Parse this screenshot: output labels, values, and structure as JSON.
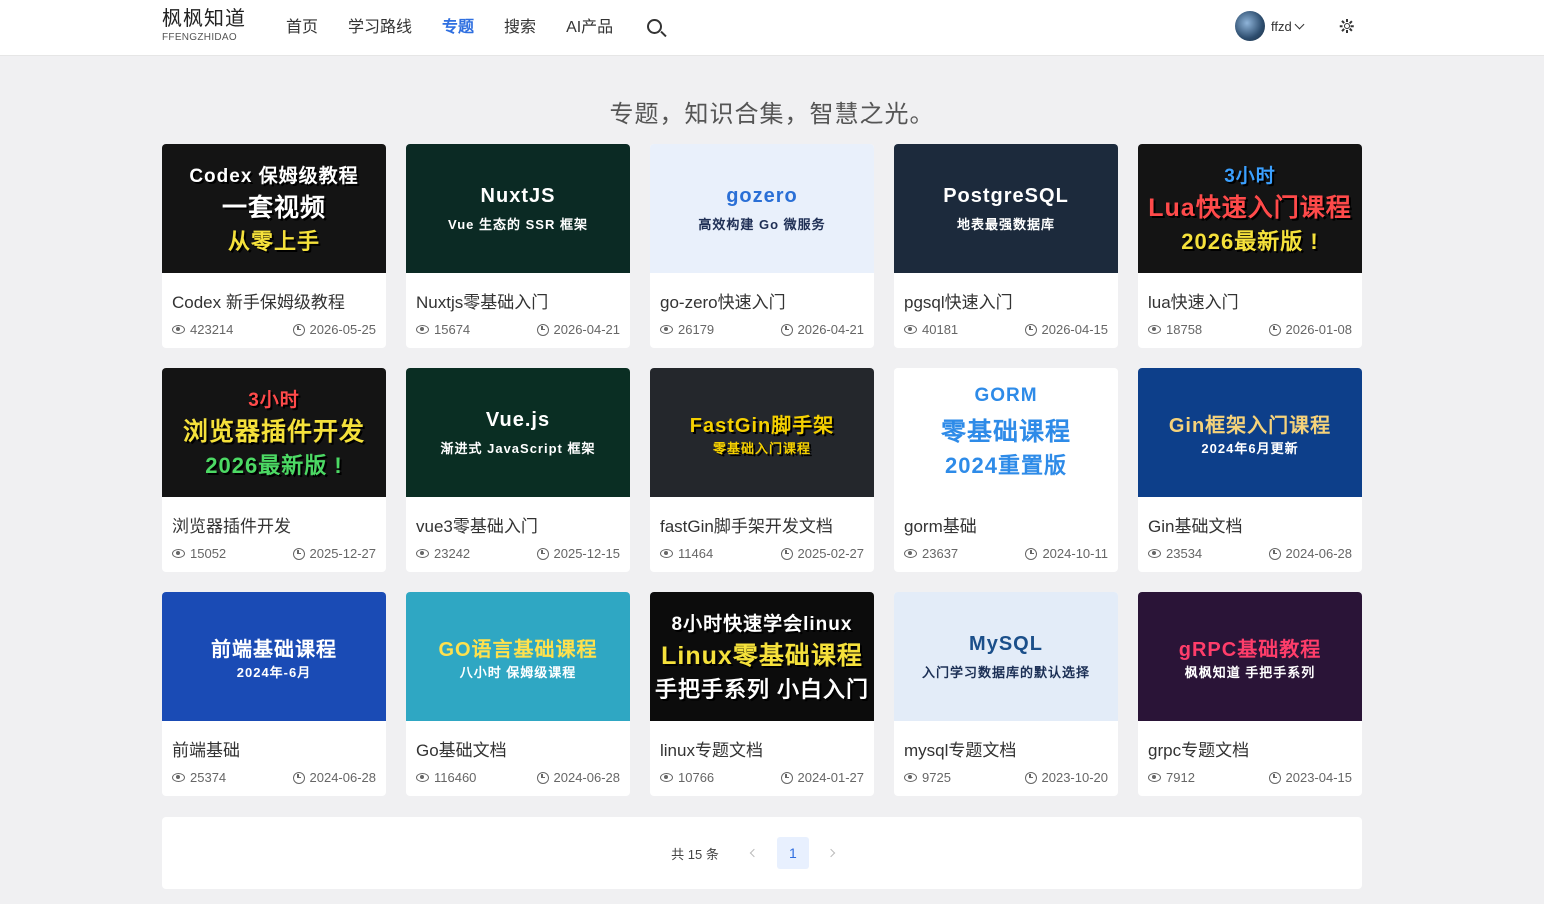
{
  "header": {
    "logo_title": "枫枫知道",
    "logo_sub": "FFENGZHIDAO",
    "nav": [
      "首页",
      "学习路线",
      "专题",
      "搜索",
      "AI产品"
    ],
    "active_index": 2,
    "user_name": "ffzd"
  },
  "slogan": "专题，知识合集，智慧之光。",
  "cards": [
    {
      "title": "Codex 新手保姆级教程",
      "views": "423214",
      "date": "2026-05-25",
      "cover": {
        "bg": "#141414",
        "lines": [
          {
            "t": "Codex 保姆级教程",
            "c": "#ffffff"
          },
          {
            "t": "一套视频",
            "c": "#ffffff"
          },
          {
            "t": "从零上手",
            "c": "#f5e13b"
          }
        ]
      }
    },
    {
      "title": "Nuxtjs零基础入门",
      "views": "15674",
      "date": "2026-04-21",
      "cover": {
        "bg": "#0b2a24",
        "lines": [
          {
            "t": "NuxtJS",
            "c": "#ffffff"
          },
          {
            "t": "Vue 生态的 SSR 框架",
            "c": "#ffffff"
          }
        ]
      }
    },
    {
      "title": "go-zero快速入门",
      "views": "26179",
      "date": "2026-04-21",
      "cover": {
        "bg": "#e9f0fb",
        "lines": [
          {
            "t": "gozero",
            "c": "#2a6fd6"
          },
          {
            "t": "高效构建 Go 微服务",
            "c": "#1f2f55"
          }
        ]
      }
    },
    {
      "title": "pgsql快速入门",
      "views": "40181",
      "date": "2026-04-15",
      "cover": {
        "bg": "#1c2a3c",
        "lines": [
          {
            "t": "PostgreSQL",
            "c": "#ffffff"
          },
          {
            "t": "地表最强数据库",
            "c": "#ffffff"
          }
        ]
      }
    },
    {
      "title": "lua快速入门",
      "views": "18758",
      "date": "2026-01-08",
      "cover": {
        "bg": "#141414",
        "lines": [
          {
            "t": "3小时",
            "c": "#3ba0ff"
          },
          {
            "t": "Lua快速入门课程",
            "c": "#ff4a4a"
          },
          {
            "t": "2026最新版 !",
            "c": "#f5e13b"
          }
        ]
      }
    },
    {
      "title": "浏览器插件开发",
      "views": "15052",
      "date": "2025-12-27",
      "cover": {
        "bg": "#141414",
        "lines": [
          {
            "t": "3小时",
            "c": "#ff4a4a"
          },
          {
            "t": "浏览器插件开发",
            "c": "#f5e13b"
          },
          {
            "t": "2026最新版 !",
            "c": "#4cd964"
          }
        ]
      }
    },
    {
      "title": "vue3零基础入门",
      "views": "23242",
      "date": "2025-12-15",
      "cover": {
        "bg": "#0a2e23",
        "lines": [
          {
            "t": "Vue.js",
            "c": "#ffffff"
          },
          {
            "t": "渐进式 JavaScript 框架",
            "c": "#ffffff"
          }
        ]
      }
    },
    {
      "title": "fastGin脚手架开发文档",
      "views": "11464",
      "date": "2025-02-27",
      "cover": {
        "bg": "#24272c",
        "lines": [
          {
            "t": "FastGin脚手架",
            "c": "#f5d000"
          },
          {
            "t": "零基础入门课程",
            "c": "#f5d000"
          }
        ]
      }
    },
    {
      "title": "gorm基础",
      "views": "23637",
      "date": "2024-10-11",
      "cover": {
        "bg": "#ffffff",
        "lines": [
          {
            "t": "GORM",
            "c": "#2e8be8"
          },
          {
            "t": "零基础课程",
            "c": "#2e8be8"
          },
          {
            "t": "2024重置版",
            "c": "#2e8be8"
          }
        ]
      }
    },
    {
      "title": "Gin基础文档",
      "views": "23534",
      "date": "2024-06-28",
      "cover": {
        "bg": "#0d3f8a",
        "lines": [
          {
            "t": "Gin框架入门课程",
            "c": "#f5d27a"
          },
          {
            "t": "2024年6月更新",
            "c": "#ffffff"
          }
        ]
      }
    },
    {
      "title": "前端基础",
      "views": "25374",
      "date": "2024-06-28",
      "cover": {
        "bg": "#1a4bb5",
        "lines": [
          {
            "t": "前端基础课程",
            "c": "#ffffff"
          },
          {
            "t": "2024年-6月",
            "c": "#ffffff"
          }
        ]
      }
    },
    {
      "title": "Go基础文档",
      "views": "116460",
      "date": "2024-06-28",
      "cover": {
        "bg": "#2fa7c3",
        "lines": [
          {
            "t": "GO语言基础课程",
            "c": "#ffe14d"
          },
          {
            "t": "八小时 保姆级课程",
            "c": "#ffffff"
          }
        ]
      }
    },
    {
      "title": "linux专题文档",
      "views": "10766",
      "date": "2024-01-27",
      "cover": {
        "bg": "#0c0c0c",
        "lines": [
          {
            "t": "8小时快速学会linux",
            "c": "#ffffff"
          },
          {
            "t": "Linux零基础课程",
            "c": "#f5e13b"
          },
          {
            "t": "手把手系列 小白入门",
            "c": "#ffffff"
          }
        ]
      }
    },
    {
      "title": "mysql专题文档",
      "views": "9725",
      "date": "2023-10-20",
      "cover": {
        "bg": "#e3ecf8",
        "lines": [
          {
            "t": "MySQL",
            "c": "#1b4f8a"
          },
          {
            "t": "入门学习数据库的默认选择",
            "c": "#1b2f55"
          }
        ]
      }
    },
    {
      "title": "grpc专题文档",
      "views": "7912",
      "date": "2023-04-15",
      "cover": {
        "bg": "#2a1437",
        "lines": [
          {
            "t": "gRPC基础教程",
            "c": "#ff3d6a"
          },
          {
            "t": "枫枫知道 手把手系列",
            "c": "#ffffff"
          }
        ]
      }
    }
  ],
  "pagination": {
    "total_text": "共 15 条",
    "current": "1"
  }
}
